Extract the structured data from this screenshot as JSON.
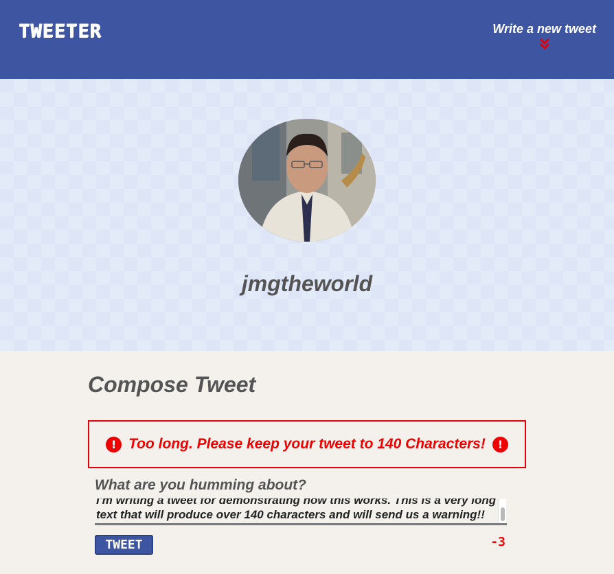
{
  "navbar": {
    "brand": "TWEETER",
    "compose_link": "Write a new tweet",
    "compose_icon": "double-chevron-down-icon",
    "accent_color": "#3e55a1"
  },
  "profile": {
    "avatar_alt": "avatar",
    "username": "jmgtheworld"
  },
  "compose": {
    "title": "Compose Tweet",
    "error_icon": "exclamation-circle-icon",
    "error_message": "Too long. Please keep your tweet to 140 Characters!",
    "error_color": "#ee0000",
    "placeholder_label": "What are you humming about?",
    "tweet_text": "I'm writing a tweet for demonstrating how this works. This is a very long text that will produce over 140 characters and will send us a warning!!",
    "submit_label": "TWEET",
    "char_counter": "-3"
  }
}
